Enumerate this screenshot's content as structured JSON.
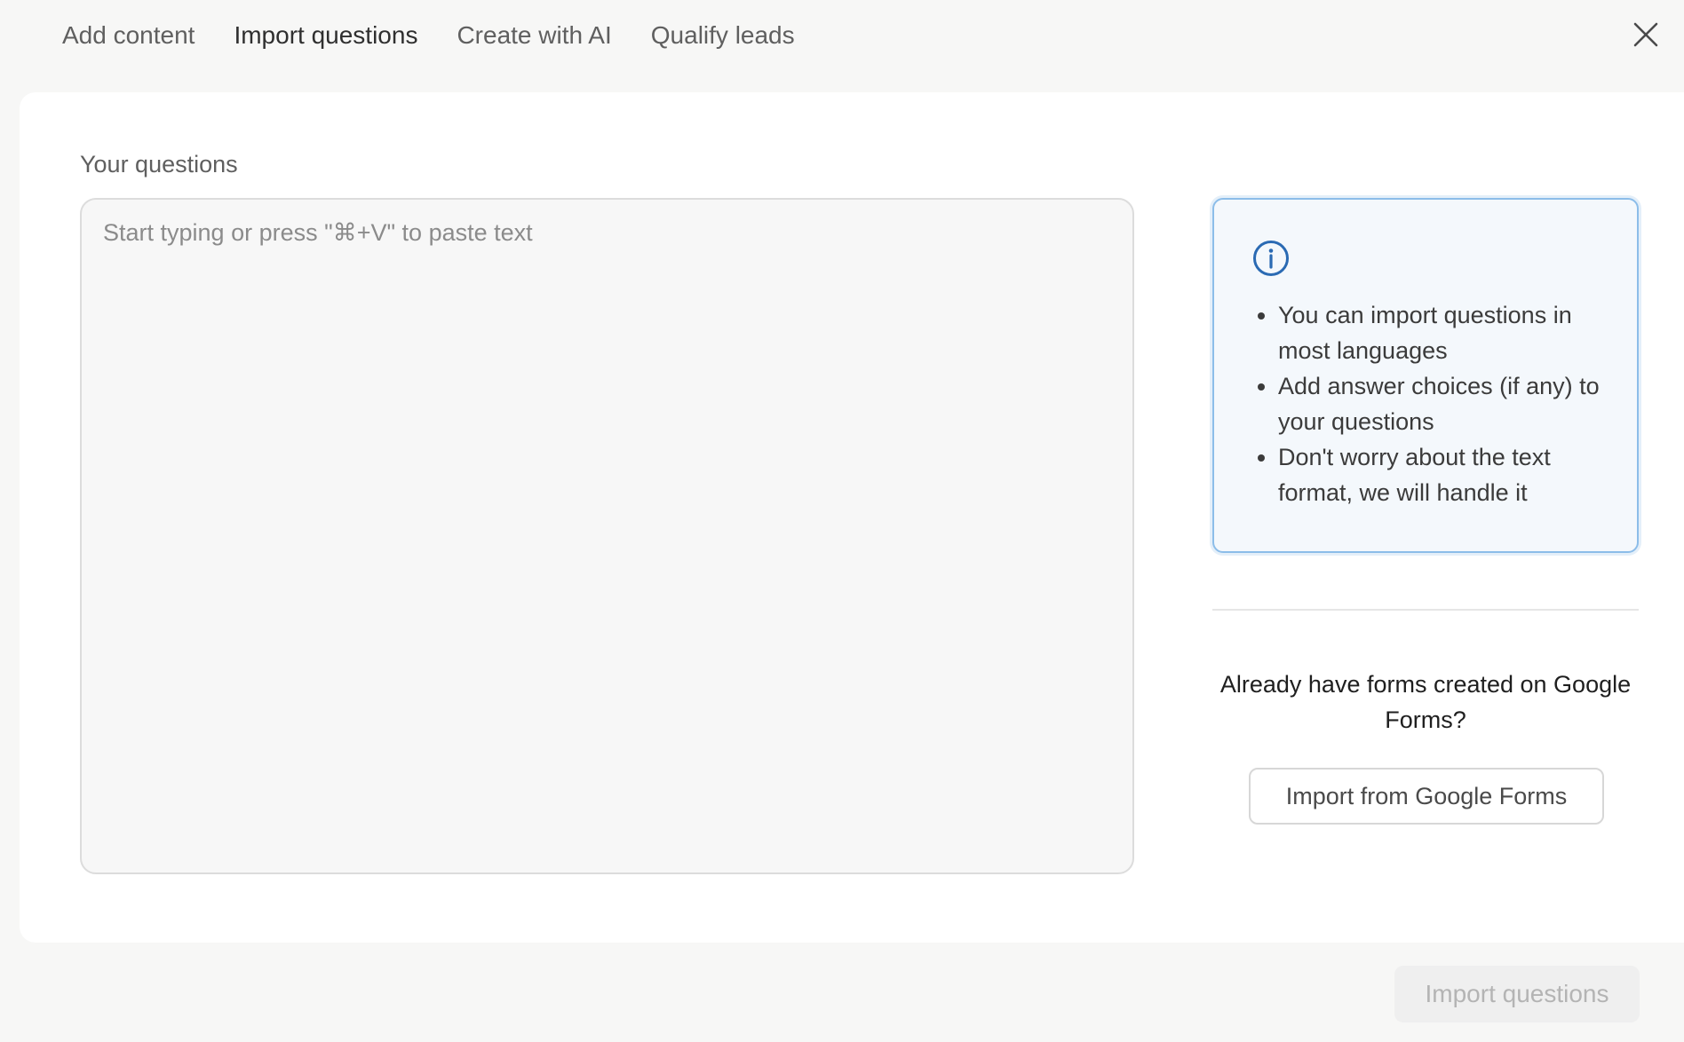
{
  "tabs": [
    {
      "label": "Add content"
    },
    {
      "label": "Import questions"
    },
    {
      "label": "Create with AI"
    },
    {
      "label": "Qualify leads"
    }
  ],
  "active_tab": "Import questions",
  "main": {
    "label": "Your questions",
    "placeholder": "Start typing or press \"⌘+V\" to paste text",
    "value": ""
  },
  "info": {
    "icon": "info-circle-icon",
    "tips": [
      "You can import questions in most languages",
      "Add answer choices (if any) to your questions",
      "Don't worry about the text format, we will handle it"
    ]
  },
  "google": {
    "prompt": "Already have forms created on Google Forms?",
    "button_label": "Import from Google Forms"
  },
  "footer": {
    "import_label": "Import questions"
  },
  "colors": {
    "info_accent": "#2a6ab3",
    "info_border": "#8cbde9",
    "info_bg": "#f4f8fc"
  }
}
